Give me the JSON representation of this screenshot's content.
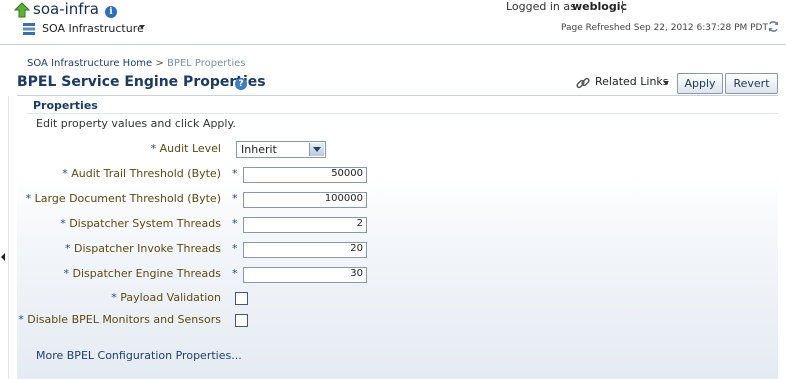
{
  "header": {
    "app_title": "soa-infra",
    "menu_label": "SOA Infrastructure",
    "login_label": "Logged in as",
    "login_user": "weblogic",
    "refresh_text": "Page Refreshed Sep 22, 2012 6:37:28 PM PDT"
  },
  "breadcrumb": {
    "home": "SOA Infrastructure Home",
    "separator": ">",
    "current": "BPEL Properties"
  },
  "page": {
    "title": "BPEL Service Engine Properties",
    "related_links": "Related Links",
    "apply": "Apply",
    "revert": "Revert"
  },
  "properties": {
    "section_title": "Properties",
    "instructions": "Edit property values and click Apply.",
    "required_mark": "*",
    "fields": {
      "audit_level": {
        "label": "Audit Level",
        "value": "Inherit"
      },
      "audit_trail": {
        "label": "Audit Trail Threshold (Byte)",
        "value": "50000"
      },
      "large_doc": {
        "label": "Large Document Threshold (Byte)",
        "value": "100000"
      },
      "disp_system": {
        "label": "Dispatcher System Threads",
        "value": "2"
      },
      "disp_invoke": {
        "label": "Dispatcher Invoke Threads",
        "value": "20"
      },
      "disp_engine": {
        "label": "Dispatcher Engine Threads",
        "value": "30"
      },
      "payload_validation": {
        "label": "Payload Validation",
        "checked": false
      },
      "disable_monitors": {
        "label": "Disable BPEL Monitors and Sensors",
        "checked": false
      }
    },
    "more_link": "More BPEL Configuration Properties..."
  },
  "colors": {
    "accent": "#1c3a63",
    "label": "#5b4a14",
    "link": "#1d3f6e"
  }
}
